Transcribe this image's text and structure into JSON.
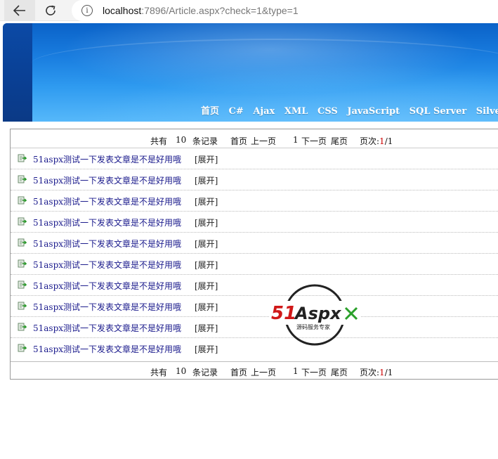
{
  "browser": {
    "url_host": "localhost",
    "url_rest": ":7896/Article.aspx?check=1&type=1"
  },
  "nav": {
    "items": [
      "首页",
      "C#",
      "Ajax",
      "XML",
      "CSS",
      "JavaScript",
      "SQL Server",
      "SilverLi"
    ]
  },
  "pager": {
    "total_prefix": "共有",
    "total_count": "10",
    "total_suffix": "条记录",
    "first": "首页",
    "prev": "上一页",
    "current": "1",
    "next": "下一页",
    "last": "尾页",
    "pages_label": "页次:",
    "page_current": "1",
    "page_sep": "/",
    "page_total": "1"
  },
  "articles": [
    {
      "title": "51aspx测试一下发表文章是不是好用哦",
      "expand": "[展开]"
    },
    {
      "title": "51aspx测试一下发表文章是不是好用哦",
      "expand": "[展开]"
    },
    {
      "title": "51aspx测试一下发表文章是不是好用哦",
      "expand": "[展开]"
    },
    {
      "title": "51aspx测试一下发表文章是不是好用哦",
      "expand": "[展开]"
    },
    {
      "title": "51aspx测试一下发表文章是不是好用哦",
      "expand": "[展开]"
    },
    {
      "title": "51aspx测试一下发表文章是不是好用哦",
      "expand": "[展开]"
    },
    {
      "title": "51aspx测试一下发表文章是不是好用哦",
      "expand": "[展开]"
    },
    {
      "title": "51aspx测试一下发表文章是不是好用哦",
      "expand": "[展开]"
    },
    {
      "title": "51aspx测试一下发表文章是不是好用哦",
      "expand": "[展开]"
    },
    {
      "title": "51aspx测试一下发表文章是不是好用哦",
      "expand": "[展开]"
    }
  ],
  "watermark": {
    "brand_red": "51",
    "brand_rest": "Aspx",
    "tagline": "源码服务专家"
  },
  "colors": {
    "link": "#1a1a8c",
    "pager_highlight": "#cc0000",
    "banner_blue": "#1a7ee0"
  }
}
